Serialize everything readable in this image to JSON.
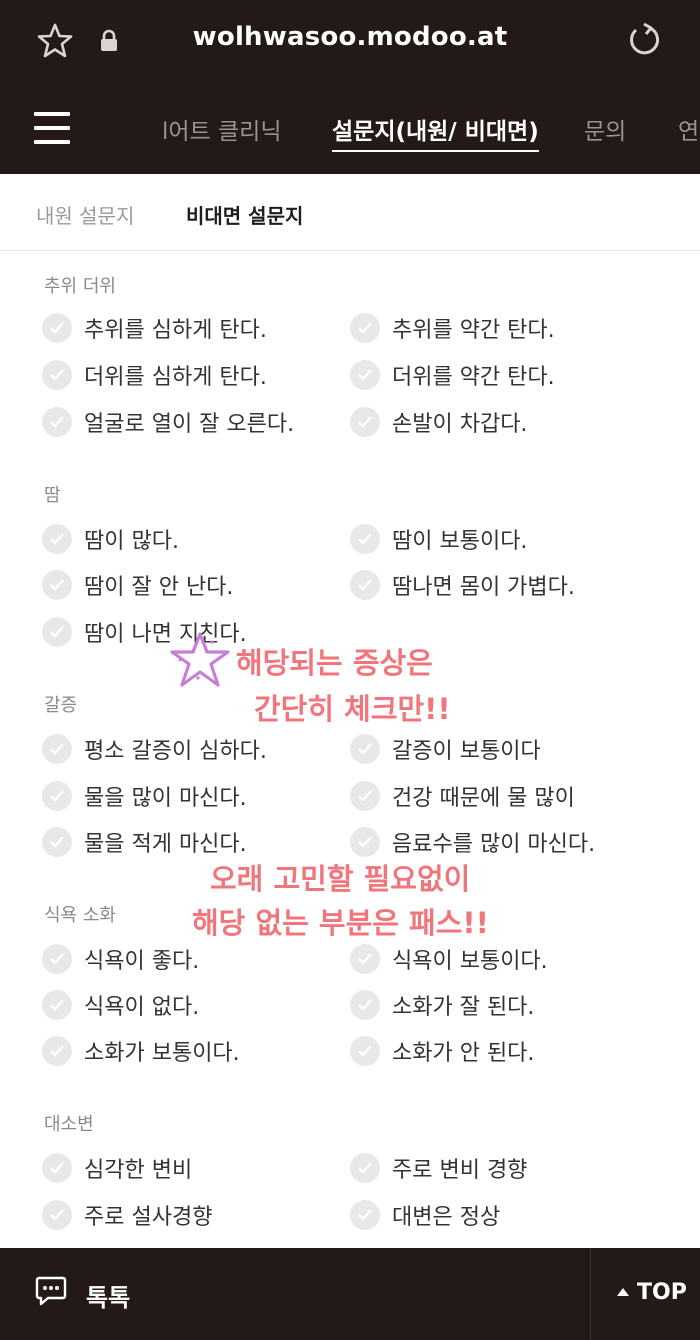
{
  "browser": {
    "url": "wolhwasoo.modoo.at"
  },
  "nav": {
    "items": [
      {
        "label": "l어트 클리닉"
      },
      {
        "label": "설문지(내원/ 비대면)"
      },
      {
        "label": "문의"
      },
      {
        "label": "연"
      }
    ],
    "active_index": 1
  },
  "subtabs": [
    {
      "label": "내원 설문지"
    },
    {
      "label": "비대면 설문지"
    }
  ],
  "sections": [
    {
      "title": "추위 더위",
      "options": [
        "추위를 심하게 탄다.",
        "추위를 약간 탄다.",
        "더위를 심하게 탄다.",
        "더위를 약간 탄다.",
        "얼굴로 열이 잘 오른다.",
        "손발이 차갑다."
      ]
    },
    {
      "title": "땀",
      "options": [
        "땀이 많다.",
        "땀이 보통이다.",
        "땀이 잘 안 난다.",
        "땀나면 몸이 가볍다.",
        "땀이 나면 지친다."
      ]
    },
    {
      "title": "갈증",
      "options": [
        "평소 갈증이 심하다.",
        "갈증이 보통이다",
        "물을 많이 마신다.",
        "건강 때문에 물 많이",
        "물을 적게 마신다.",
        "음료수를 많이 마신다."
      ]
    },
    {
      "title": "식욕 소화",
      "options": [
        "식욕이 좋다.",
        "식욕이 보통이다.",
        "식욕이 없다.",
        "소화가 잘 된다.",
        "소화가 보통이다.",
        "소화가 안 된다."
      ]
    },
    {
      "title": "대소변",
      "options": [
        "심각한 변비",
        "주로 변비 경향",
        "주로 설사경향",
        "대변은 정상"
      ]
    }
  ],
  "overlay": {
    "line1": "해당되는 증상은",
    "line2": "간단히 체크만!!",
    "line3": "오래 고민할 필요없이",
    "line4": "해당 없는 부분은 패스!!"
  },
  "bottom": {
    "talk_label": "톡톡",
    "top_label": "TOP"
  },
  "colors": {
    "header_bg": "#231a18",
    "overlay_text": "#f0767c",
    "star": "#c77ed6"
  }
}
